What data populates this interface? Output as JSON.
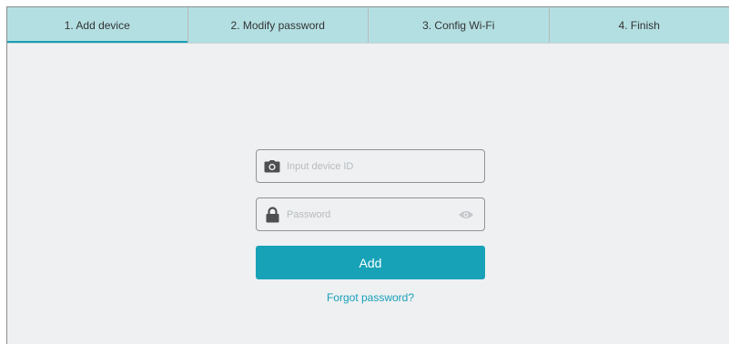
{
  "steps": [
    {
      "label": "1. Add device",
      "active": true
    },
    {
      "label": "2. Modify password",
      "active": false
    },
    {
      "label": "3. Config Wi-Fi",
      "active": false
    },
    {
      "label": "4. Finish",
      "active": false
    }
  ],
  "form": {
    "device_id": {
      "value": "",
      "placeholder": "Input device ID",
      "icon": "camera-icon"
    },
    "password": {
      "value": "",
      "placeholder": "Password",
      "icon": "lock-icon",
      "toggle_icon": "eye-icon"
    },
    "add_label": "Add",
    "forgot_label": "Forgot password?"
  },
  "colors": {
    "tab_bar": "#b3dfe2",
    "accent": "#17a2b8",
    "background": "#eef0f2"
  }
}
